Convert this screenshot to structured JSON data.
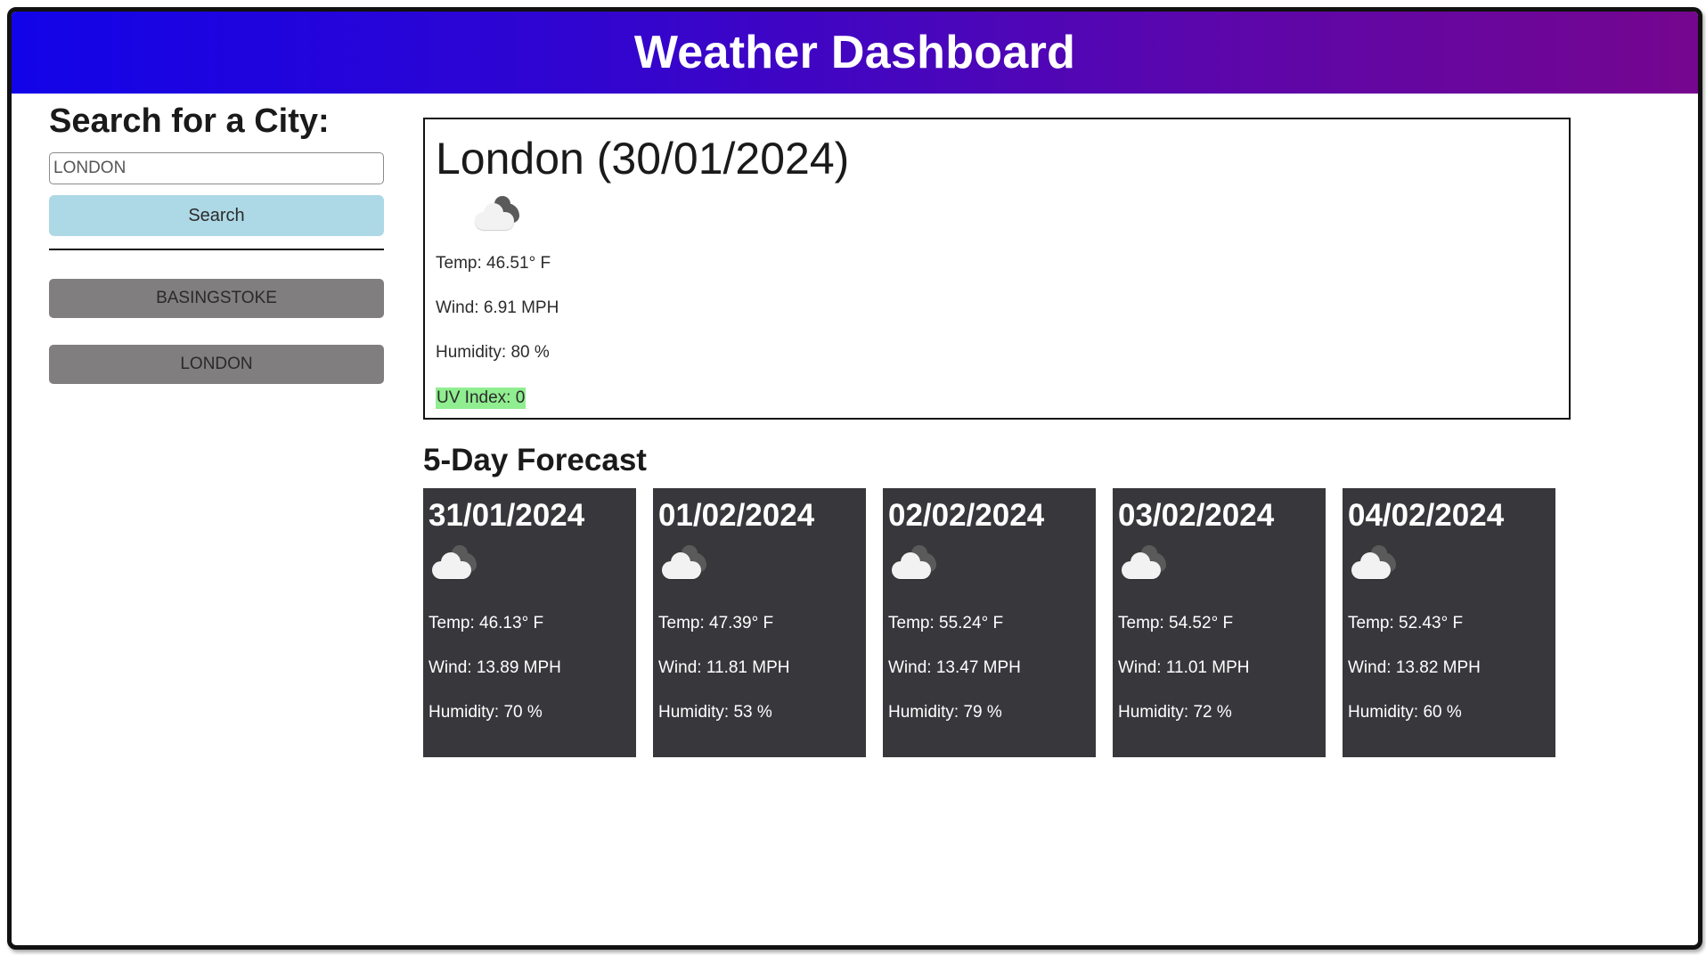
{
  "header": {
    "title": "Weather Dashboard"
  },
  "sidebar": {
    "heading": "Search for a City:",
    "search": {
      "value": "LONDON",
      "placeholder": ""
    },
    "search_button_label": "Search",
    "history": [
      "BASINGSTOKE",
      "LONDON"
    ]
  },
  "current": {
    "title": "London (30/01/2024)",
    "icon": "cloud-icon",
    "temp": "Temp: 46.51° F",
    "wind": "Wind: 6.91 MPH",
    "humidity": "Humidity: 80 %",
    "uv": "UV Index: 0"
  },
  "forecast": {
    "heading": "5-Day Forecast",
    "days": [
      {
        "date": "31/01/2024",
        "icon": "cloud-icon",
        "temp": "Temp: 46.13° F",
        "wind": "Wind: 13.89 MPH",
        "humidity": "Humidity: 70 %"
      },
      {
        "date": "01/02/2024",
        "icon": "cloud-icon",
        "temp": "Temp: 47.39° F",
        "wind": "Wind: 11.81 MPH",
        "humidity": "Humidity: 53 %"
      },
      {
        "date": "02/02/2024",
        "icon": "cloud-icon",
        "temp": "Temp: 55.24° F",
        "wind": "Wind: 13.47 MPH",
        "humidity": "Humidity: 79 %"
      },
      {
        "date": "03/02/2024",
        "icon": "cloud-icon",
        "temp": "Temp: 54.52° F",
        "wind": "Wind: 11.01 MPH",
        "humidity": "Humidity: 72 %"
      },
      {
        "date": "04/02/2024",
        "icon": "cloud-icon",
        "temp": "Temp: 52.43° F",
        "wind": "Wind: 13.82 MPH",
        "humidity": "Humidity: 60 %"
      }
    ]
  },
  "colors": {
    "header_gradient_start": "#1204e8",
    "header_gradient_end": "#75068f",
    "search_button": "#add8e6",
    "history_button": "#807e7e",
    "forecast_card": "#38383c",
    "uv_badge": "#90ee90"
  }
}
